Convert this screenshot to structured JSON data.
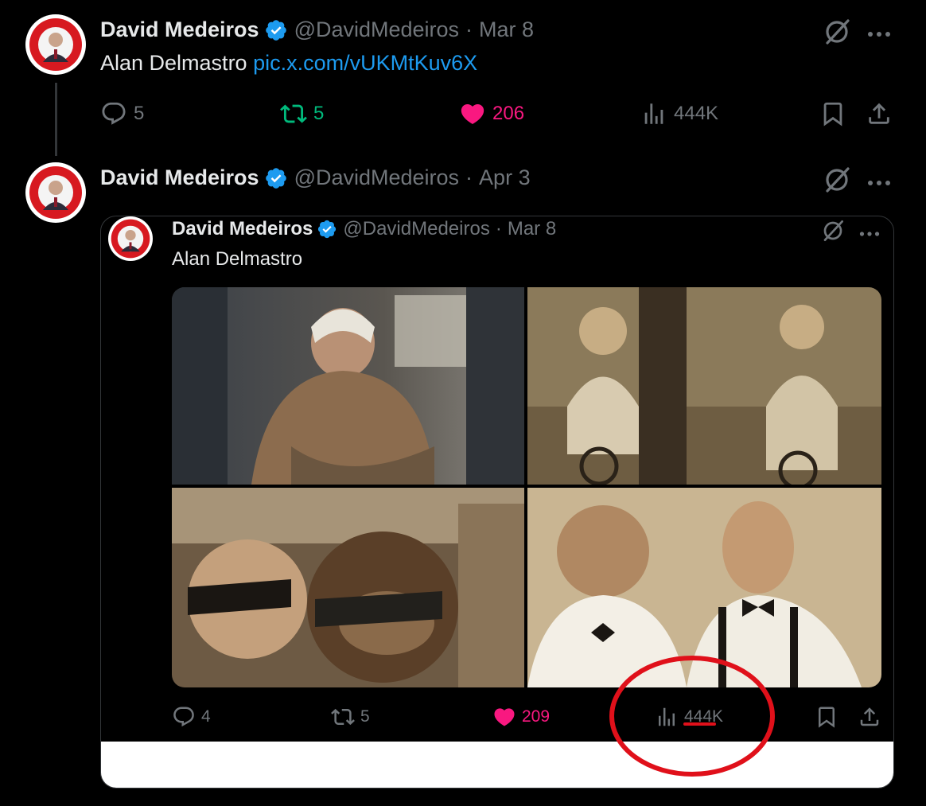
{
  "tweet1": {
    "author_name": "David Medeiros",
    "handle": "@DavidMedeiros",
    "dot": "·",
    "date": "Mar 8",
    "text": "Alan Delmastro",
    "link": "pic.x.com/vUKMtKuv6X",
    "replies": "5",
    "reposts": "5",
    "likes": "206",
    "views": "444K"
  },
  "tweet2": {
    "author_name": "David Medeiros",
    "handle": "@DavidMedeiros",
    "dot": "·",
    "date": "Apr 3"
  },
  "quoted": {
    "author_name": "David Medeiros",
    "handle": "@DavidMedeiros",
    "dot": "·",
    "date": "Mar 8",
    "text": "Alan Delmastro",
    "replies": "4",
    "reposts": "5",
    "likes": "209",
    "views": "444K"
  },
  "colors": {
    "background": "#000000",
    "text": "#e7e9ea",
    "muted": "#71767b",
    "link": "#1d9bf0",
    "like": "#f91880",
    "repost_active": "#00ba7c",
    "verified": "#1d9bf0",
    "annotation": "#e0101a"
  },
  "icons": [
    "verified-badge-icon",
    "grok-icon",
    "more-icon",
    "reply-icon",
    "repost-icon",
    "like-icon",
    "views-icon",
    "bookmark-icon",
    "share-icon"
  ]
}
